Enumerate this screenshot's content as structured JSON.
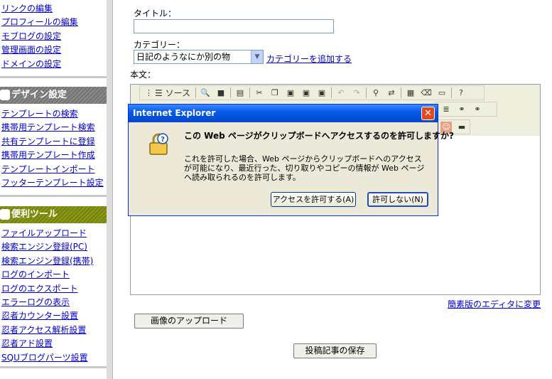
{
  "sidebar": {
    "top_links": [
      "リンクの編集",
      "プロフィールの編集",
      "モブログの設定",
      "管理画面の設定",
      "ドメインの設定"
    ],
    "design_section": {
      "title": "デザイン設定",
      "links": [
        "テンプレートの検索",
        "携帯用テンプレート検索",
        "共有テンプレートに登録",
        "携帯用テンプレート作成",
        "テンプレートインポート",
        "フッターテンプレート設定"
      ]
    },
    "tools_section": {
      "title": "便利ツール",
      "links": [
        "ファイルアップロード",
        "検索エンジン登録(PC)",
        "検索エンジン登録(携帯)",
        "ログのインポート",
        "ログのエクスポート",
        "エラーログの表示",
        "忍者カウンター設置",
        "忍者アクセス解析設置",
        "忍者アド設置",
        "SQUブログパーツ設置"
      ]
    }
  },
  "form": {
    "title_label": "タイトル：",
    "title_value": "",
    "category_label": "カテゴリー：",
    "category_selected": "日記のようなにか別の物",
    "add_category_link": "カテゴリーを追加する",
    "body_label": "本文：",
    "source_button": "ソース",
    "simple_editor_link": "簡素版のエディタに変更",
    "upload_image_button": "画像のアップロード",
    "save_button": "投稿記事の保存"
  },
  "dialog": {
    "title": "Internet Explorer",
    "close_glyph": "✕",
    "question": "この Web ページがクリップボードへアクセスするのを許可しますか?",
    "body": "これを許可した場合、Web ページからクリップボードへのアクセスが可能になり、最近行った、切り取りやコピーの情報が Web ページへ読み取られるのを許可します。",
    "allow_button": "アクセスを許可する(A)",
    "deny_button": "許可しない(N)"
  },
  "icons": {
    "design_section": "palette-icon",
    "tools_section": "toolbox-icon",
    "dialog": "lock-question-icon"
  },
  "colors": {
    "link": "#0000cc",
    "design_header": "#7d7d7d",
    "tools_header": "#7e8a10",
    "dialog_title": "#0a5ce8",
    "dialog_bg": "#ece9d8"
  }
}
